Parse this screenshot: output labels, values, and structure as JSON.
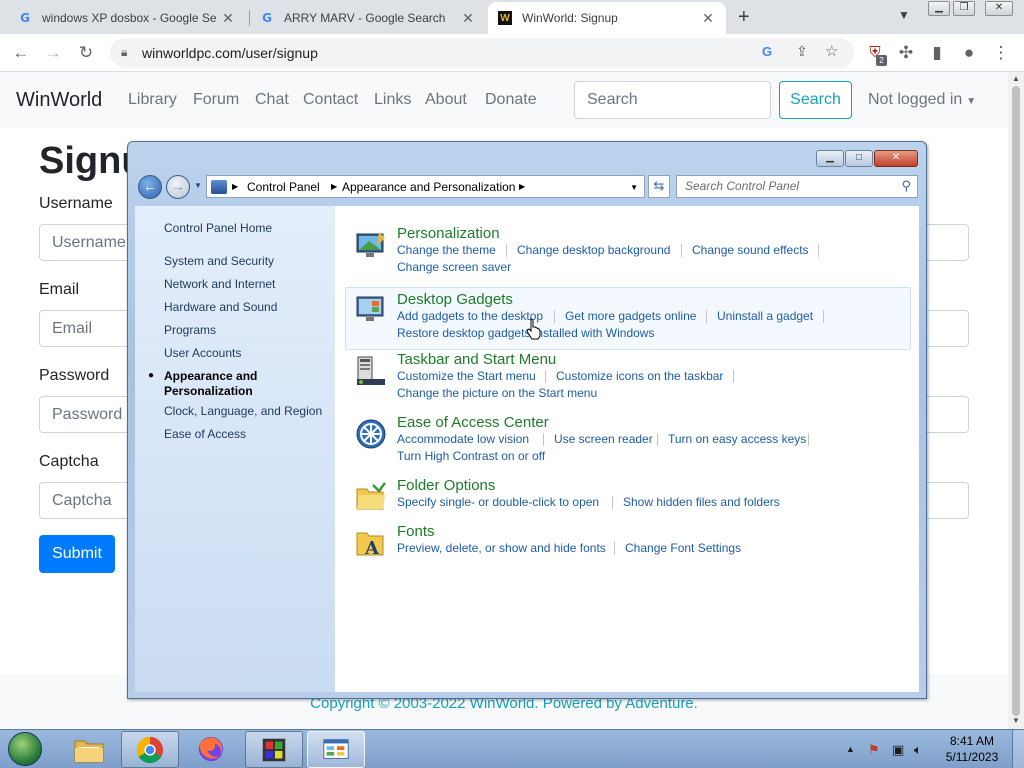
{
  "browser": {
    "tabs": [
      {
        "title": "windows XP dosbox - Google Se",
        "favicon": "google-g-icon"
      },
      {
        "title": "ARRY MARV - Google Search",
        "favicon": "google-g-icon"
      },
      {
        "title": "WinWorld: Signup",
        "favicon": "winworld-icon"
      }
    ],
    "new_tab": "+",
    "url": "winworldpc.com/user/signup",
    "extension_badge": "2"
  },
  "site": {
    "brand": "WinWorld",
    "nav": [
      "Library",
      "Forum",
      "Chat",
      "Contact",
      "Links",
      "About",
      "Donate"
    ],
    "search_placeholder": "Search",
    "search_button": "Search",
    "login": "Not logged in",
    "page_title": "Signup",
    "fields": [
      {
        "label": "Username",
        "placeholder": "Username"
      },
      {
        "label": "Email",
        "placeholder": "Email"
      },
      {
        "label": "Password",
        "placeholder": "Password"
      },
      {
        "label": "Captcha",
        "placeholder": "Captcha"
      }
    ],
    "submit": "Submit",
    "footer": "Copyright © 2003-2022 WinWorld. Powered by Adventure."
  },
  "control_panel": {
    "breadcrumb": [
      "Control Panel",
      "Appearance and Personalization"
    ],
    "search_placeholder": "Search Control Panel",
    "left_nav": [
      "Control Panel Home",
      "System and Security",
      "Network and Internet",
      "Hardware and Sound",
      "Programs",
      "User Accounts",
      "Appearance and Personalization",
      "Clock, Language, and Region",
      "Ease of Access"
    ],
    "current_nav_index": 6,
    "categories": [
      {
        "title": "Personalization",
        "icon": "personalization-icon",
        "links": [
          "Change the theme",
          "Change desktop background",
          "Change sound effects",
          "Change screen saver"
        ]
      },
      {
        "title": "Desktop Gadgets",
        "icon": "gadgets-icon",
        "links": [
          "Add gadgets to the desktop",
          "Get more gadgets online",
          "Uninstall a gadget",
          "Restore desktop gadgets installed with Windows"
        ]
      },
      {
        "title": "Taskbar and Start Menu",
        "icon": "taskbar-icon",
        "links": [
          "Customize the Start menu",
          "Customize icons on the taskbar",
          "Change the picture on the Start menu"
        ]
      },
      {
        "title": "Ease of Access Center",
        "icon": "ease-of-access-icon",
        "links": [
          "Accommodate low vision",
          "Use screen reader",
          "Turn on easy access keys",
          "Turn High Contrast on or off"
        ]
      },
      {
        "title": "Folder Options",
        "icon": "folder-options-icon",
        "links": [
          "Specify single- or double-click to open",
          "Show hidden files and folders"
        ]
      },
      {
        "title": "Fonts",
        "icon": "fonts-icon",
        "links": [
          "Preview, delete, or show and hide fonts",
          "Change Font Settings"
        ]
      }
    ]
  },
  "taskbar": {
    "apps": [
      "explorer-icon",
      "chrome-icon",
      "firefox-icon",
      "dosbox-icon",
      "control-panel-icon"
    ],
    "time": "8:41 AM",
    "date": "5/11/2023"
  },
  "colors": {
    "category_title": "#1e7b28",
    "task_link": "#1d5da5",
    "bootstrap_primary": "#007bff",
    "bootstrap_info": "#17a2b8"
  }
}
